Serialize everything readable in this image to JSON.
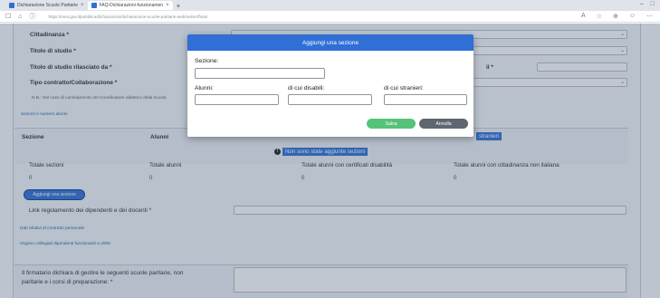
{
  "browser": {
    "tabs": [
      {
        "label": "Dichiarazione Scuole Paritarie"
      },
      {
        "label": "FAQ-Dichiarazioni-funzionamen"
      }
    ],
    "new_tab": "+",
    "url": "https://miur.gov.it/pubblica/dichiarazioni/dichiarazione-scuole-paritarie-web/voiloAffinati"
  },
  "form": {
    "cittadinanza_label": "Cittadinanza *",
    "titolo_studio_label": "Titolo di studio *",
    "titolo_rilasciato_label": "Titolo di studio rilasciato da *",
    "right_label": "il *",
    "tipo_contratto_label": "Tipo contratto/Collaborazione *",
    "note": "N.B.: Nel caso di cambiamento del Coordinatore didattico della scuola",
    "section_link": "Sezioni e numero alunni",
    "table": {
      "col_sezione": "Sezione",
      "col_alunni": "Alunni",
      "col_stranieri": "stranieri",
      "empty_message": "Non sono state aggiunte sezioni"
    },
    "totals": {
      "labels": [
        "Totale sezioni",
        "Totale alunni",
        "Totale alunni con certificati disabilità",
        "Totale alunni con cittadinanza non italiana"
      ],
      "values": [
        "0",
        "0",
        "0",
        "0"
      ]
    },
    "add_section_button": "Aggiungi una sezione",
    "link_regolamento_label": "Link regolamento dei dipendenti e dei docenti *",
    "links": [
      "Dati relativi al contratto personale",
      "Organo collegiali dipendenti funzionanti a 2000"
    ],
    "firmatario_label_1": "Il firmatario dichiara di gestire le seguenti scuole paritarie, non",
    "firmatario_label_2": "paritarie e i corsi di preparazione: *"
  },
  "modal": {
    "title": "Aggiungi una sezione",
    "sezione_label": "Sezione:",
    "alunni_label": "Alunni:",
    "disabili_label": "di cui disabili:",
    "stranieri_label": "di cui stranieri:",
    "save_label": "Salva",
    "cancel_label": "Annulla"
  }
}
